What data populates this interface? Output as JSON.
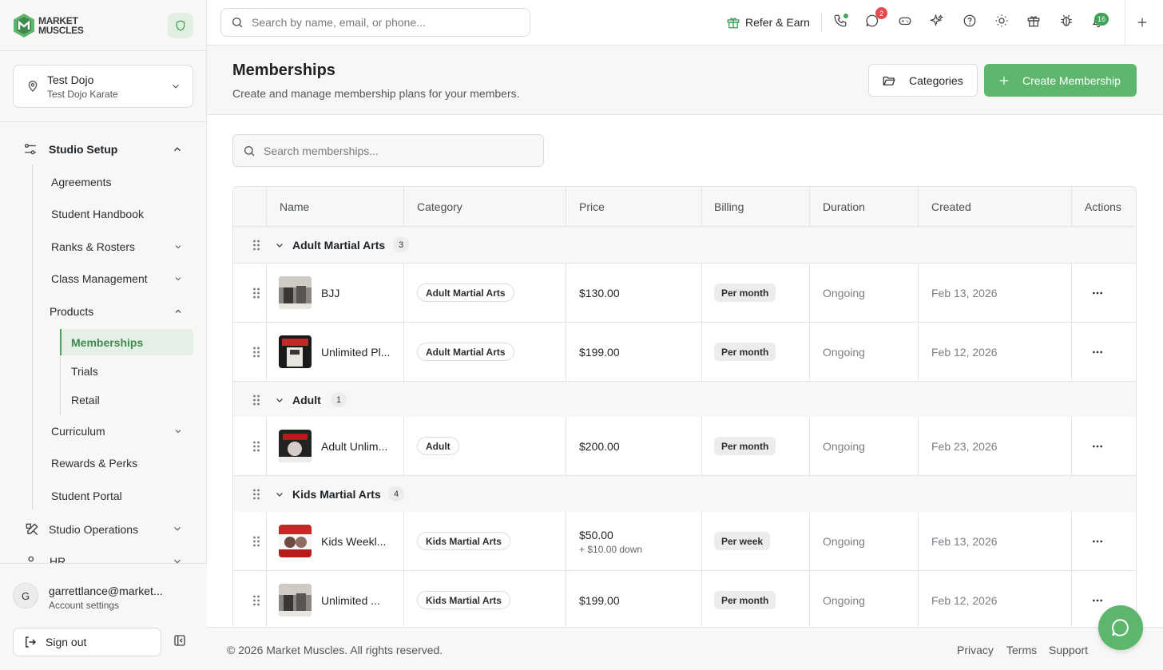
{
  "brand": {
    "logo_line1": "MARKET",
    "logo_line2": "MUSCLES"
  },
  "location": {
    "name": "Test Dojo",
    "subtitle": "Test Dojo Karate"
  },
  "sidebar": {
    "studio_setup": "Studio Setup",
    "items": {
      "agreements": "Agreements",
      "handbook": "Student Handbook",
      "ranks": "Ranks & Rosters",
      "classes": "Class Management",
      "products": "Products",
      "memberships": "Memberships",
      "trials": "Trials",
      "retail": "Retail",
      "curriculum": "Curriculum",
      "rewards": "Rewards & Perks",
      "portal": "Student Portal"
    },
    "studio_operations": "Studio Operations",
    "hr": "HR"
  },
  "user": {
    "initial": "G",
    "email": "garrettlance@market...",
    "sub": "Account settings",
    "sign_out": "Sign out"
  },
  "header": {
    "search_placeholder": "Search by name, email, or phone...",
    "refer": "Refer & Earn",
    "messages_badge": "2",
    "notifications_badge": "16"
  },
  "page": {
    "title": "Memberships",
    "subtitle": "Create and manage membership plans for your members.",
    "categories_btn": "Categories",
    "create_btn": "Create Membership",
    "search_placeholder": "Search memberships..."
  },
  "table": {
    "headers": {
      "name": "Name",
      "category": "Category",
      "price": "Price",
      "billing": "Billing",
      "duration": "Duration",
      "created": "Created",
      "actions": "Actions"
    },
    "groups": [
      {
        "name": "Adult Martial Arts",
        "count": "3"
      },
      {
        "name": "Adult",
        "count": "1"
      },
      {
        "name": "Kids Martial Arts",
        "count": "4"
      }
    ],
    "rows": [
      {
        "name": "BJJ",
        "category": "Adult Martial Arts",
        "price": "$130.00",
        "price_sub": "",
        "billing": "Per month",
        "duration": "Ongoing",
        "created": "Feb 13, 2026"
      },
      {
        "name": "Unlimited Pl...",
        "category": "Adult Martial Arts",
        "price": "$199.00",
        "price_sub": "",
        "billing": "Per month",
        "duration": "Ongoing",
        "created": "Feb 12, 2026"
      },
      {
        "name": "Adult Unlim...",
        "category": "Adult",
        "price": "$200.00",
        "price_sub": "",
        "billing": "Per month",
        "duration": "Ongoing",
        "created": "Feb 23, 2026"
      },
      {
        "name": "Kids Weekl...",
        "category": "Kids Martial Arts",
        "price": "$50.00",
        "price_sub": "+ $10.00 down",
        "billing": "Per week",
        "duration": "Ongoing",
        "created": "Feb 13, 2026"
      },
      {
        "name": "Unlimited ...",
        "category": "Kids Martial Arts",
        "price": "$199.00",
        "price_sub": "",
        "billing": "Per month",
        "duration": "Ongoing",
        "created": "Feb 12, 2026"
      }
    ]
  },
  "footer": {
    "copyright": "© 2026 Market Muscles. All rights reserved.",
    "privacy": "Privacy",
    "terms": "Terms",
    "support": "Support"
  },
  "colors": {
    "accent": "#5cb66c",
    "accent_dark": "#3f8a4e",
    "badge_red": "#e5484d",
    "badge_green": "#3fa35a"
  }
}
